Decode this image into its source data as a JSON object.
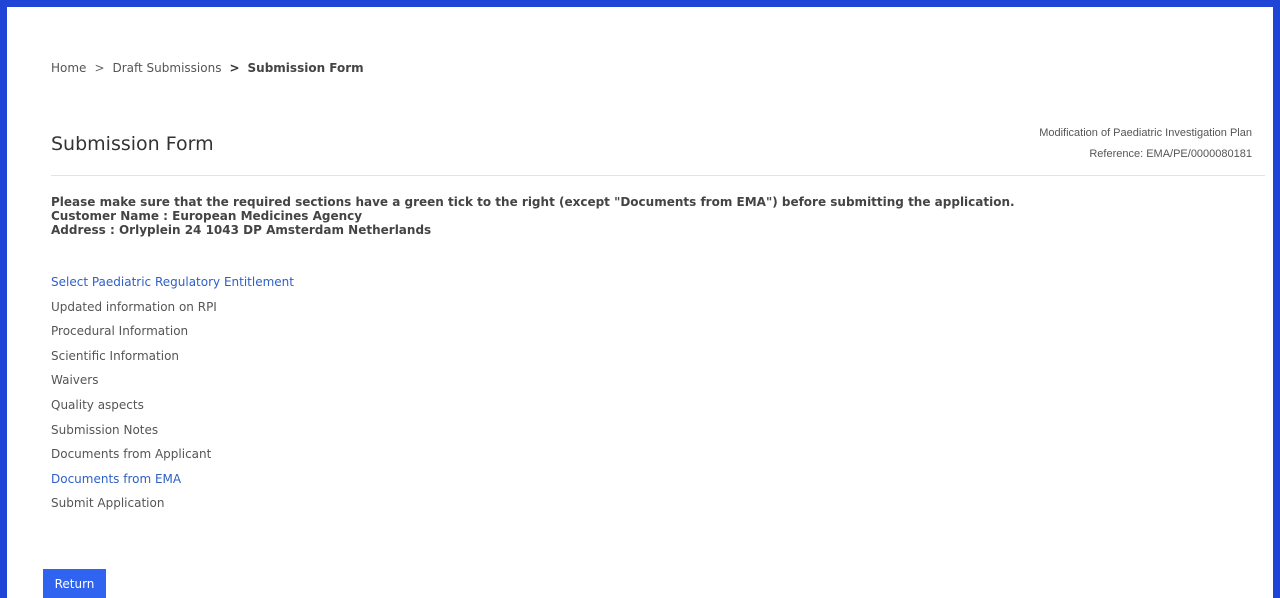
{
  "breadcrumb": {
    "home": "Home",
    "sep1": ">",
    "drafts": "Draft Submissions",
    "sep2": ">",
    "current": "Submission Form"
  },
  "page": {
    "title": "Submission Form",
    "procedure_type": "Modification of Paediatric Investigation Plan",
    "reference": "Reference: EMA/PE/0000080181"
  },
  "instructions": {
    "notice": "Please make sure that the required sections have a green tick to the right (except \"Documents from EMA\") before submitting the application.",
    "customer": "Customer Name : European Medicines Agency",
    "address": "Address : Orlyplein 24 1043 DP Amsterdam Netherlands"
  },
  "sections": [
    {
      "label": "Select Paediatric Regulatory Entitlement",
      "highlighted": true
    },
    {
      "label": "Updated information on RPI",
      "highlighted": false
    },
    {
      "label": "Procedural Information",
      "highlighted": false
    },
    {
      "label": "Scientific Information",
      "highlighted": false
    },
    {
      "label": "Waivers",
      "highlighted": false
    },
    {
      "label": "Quality aspects",
      "highlighted": false
    },
    {
      "label": "Submission Notes",
      "highlighted": false
    },
    {
      "label": "Documents from Applicant",
      "highlighted": false
    },
    {
      "label": "Documents from EMA",
      "highlighted": true
    },
    {
      "label": "Submit Application",
      "highlighted": false
    }
  ],
  "actions": {
    "return_label": "Return"
  },
  "colors": {
    "frame_border": "#1f45d6",
    "link": "#2e5fc9",
    "button": "#2f63f0"
  }
}
